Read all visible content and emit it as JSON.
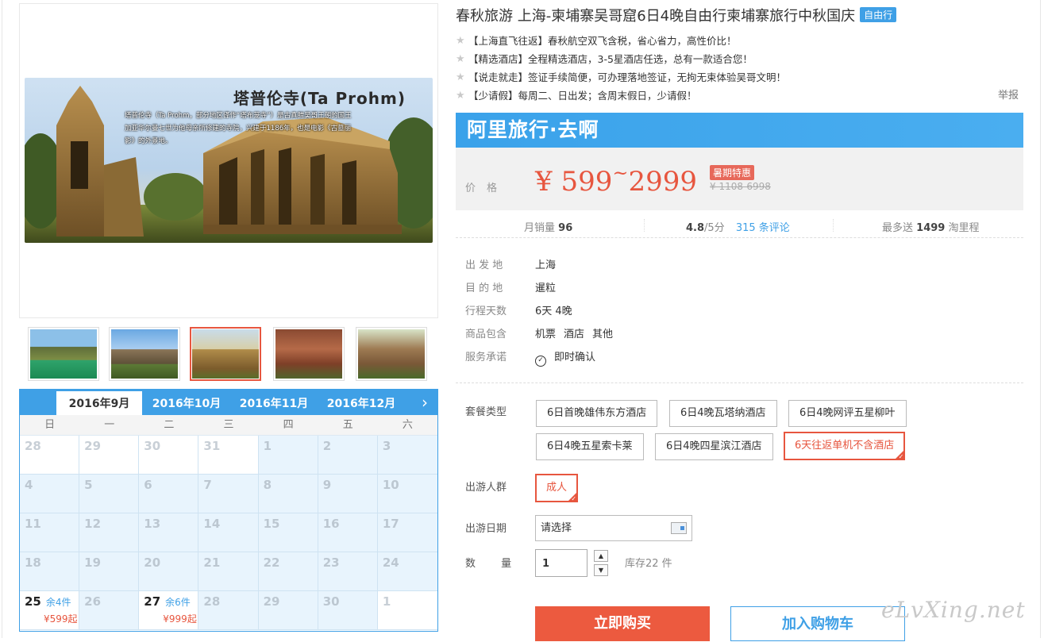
{
  "product": {
    "title": "春秋旅游 上海-柬埔寨吴哥窟6日4晚自由行柬埔寨旅行中秋国庆",
    "tag": "自由行"
  },
  "highlights": [
    "【上海直飞往返】春秋航空双飞含税，省心省力，高性价比！",
    "【精选酒店】全程精选酒店，3-5星酒店任选，总有一款适合您！",
    "【说走就走】签证手续简便，可办理落地签证，无拘无束体验吴哥文明！",
    "【少请假】每周二、日出发；含周末假日，少请假！"
  ],
  "report_label": "举报",
  "main_image": {
    "title": "塔普伦寺(Ta Prohm)",
    "caption": "塔普伦寺（Ta Prohm，部分地区译作“塔布茏寺”）是古真腊吴哥王朝的国王加亚华尔曼七世为他母亲所修建的寺院，兴建于1186年，也是电影《古墓丽影》的外景地。"
  },
  "thumbnails": [
    {
      "name": "thumb-angkor-wat-banner",
      "selected": false
    },
    {
      "name": "thumb-angkor-temple",
      "selected": false
    },
    {
      "name": "thumb-ta-prohm",
      "selected": true
    },
    {
      "name": "thumb-banteay-srei",
      "selected": false
    },
    {
      "name": "thumb-ruins",
      "selected": false
    }
  ],
  "calendar": {
    "tabs": [
      "2016年9月",
      "2016年10月",
      "2016年11月",
      "2016年12月"
    ],
    "active_tab": 0,
    "weekdays": [
      "日",
      "一",
      "二",
      "三",
      "四",
      "五",
      "六"
    ],
    "days": [
      {
        "d": "28",
        "s": "white"
      },
      {
        "d": "29",
        "s": "white"
      },
      {
        "d": "30",
        "s": "white"
      },
      {
        "d": "31",
        "s": "white"
      },
      {
        "d": "1",
        "s": "blue"
      },
      {
        "d": "2",
        "s": "blue"
      },
      {
        "d": "3",
        "s": "blue"
      },
      {
        "d": "4",
        "s": "blue"
      },
      {
        "d": "5",
        "s": "blue"
      },
      {
        "d": "6",
        "s": "blue"
      },
      {
        "d": "7",
        "s": "blue"
      },
      {
        "d": "8",
        "s": "blue"
      },
      {
        "d": "9",
        "s": "blue"
      },
      {
        "d": "10",
        "s": "blue"
      },
      {
        "d": "11",
        "s": "blue"
      },
      {
        "d": "12",
        "s": "blue"
      },
      {
        "d": "13",
        "s": "blue"
      },
      {
        "d": "14",
        "s": "blue"
      },
      {
        "d": "15",
        "s": "blue"
      },
      {
        "d": "16",
        "s": "blue"
      },
      {
        "d": "17",
        "s": "blue"
      },
      {
        "d": "18",
        "s": "blue"
      },
      {
        "d": "19",
        "s": "blue"
      },
      {
        "d": "20",
        "s": "blue"
      },
      {
        "d": "21",
        "s": "blue"
      },
      {
        "d": "22",
        "s": "blue"
      },
      {
        "d": "23",
        "s": "blue"
      },
      {
        "d": "24",
        "s": "blue"
      },
      {
        "d": "25",
        "s": "avail",
        "stock": "余4件",
        "price": "¥599起"
      },
      {
        "d": "26",
        "s": "blue"
      },
      {
        "d": "27",
        "s": "avail",
        "stock": "余6件",
        "price": "¥999起"
      },
      {
        "d": "28",
        "s": "blue"
      },
      {
        "d": "29",
        "s": "blue"
      },
      {
        "d": "30",
        "s": "blue"
      },
      {
        "d": "1",
        "s": "white"
      }
    ]
  },
  "brand": "阿里旅行·去啊",
  "price": {
    "label": "价格",
    "low": "599",
    "high": "2999",
    "currency": "¥",
    "tilde": "~",
    "badge": "暑期特惠",
    "original": "¥ 1108-6998"
  },
  "stats": {
    "monthly_sales_label": "月销量",
    "monthly_sales_value": "96",
    "rating": "4.8",
    "rating_suffix": "/5分",
    "reviews": "315 条评论",
    "points_prefix": "最多送",
    "points_value": "1499",
    "points_suffix": "淘里程"
  },
  "info": {
    "departure_label": "出 发 地",
    "departure_value": "上海",
    "destination_label": "目 的 地",
    "destination_value": "暹粒",
    "duration_label": "行程天数",
    "duration_value": "6天 4晚",
    "includes_label": "商品包含",
    "includes_values": [
      "机票",
      "酒店",
      "其他"
    ],
    "service_label": "服务承诺",
    "service_value": "即时确认"
  },
  "options": {
    "package_label": "套餐类型",
    "packages": [
      {
        "label": "6日首晚雄伟东方酒店",
        "selected": false
      },
      {
        "label": "6日4晚瓦塔纳酒店",
        "selected": false
      },
      {
        "label": "6日4晚网评五星柳叶",
        "selected": false
      },
      {
        "label": "6日4晚五星索卡莱",
        "selected": false
      },
      {
        "label": "6日4晚四星滨江酒店",
        "selected": false
      },
      {
        "label": "6天往返单机不含酒店",
        "selected": true
      }
    ],
    "traveler_label": "出游人群",
    "traveler_value": "成人",
    "date_label": "出游日期",
    "date_value": "请选择",
    "qty_label": "数 量",
    "qty_value": "1",
    "stock_text": "库存22 件"
  },
  "actions": {
    "buy_now": "立即购买",
    "add_cart": "加入购物车"
  },
  "watermark": "eLvXing.net",
  "colors": {
    "accent_blue": "#3fa0e6",
    "accent_red": "#e7563f"
  }
}
